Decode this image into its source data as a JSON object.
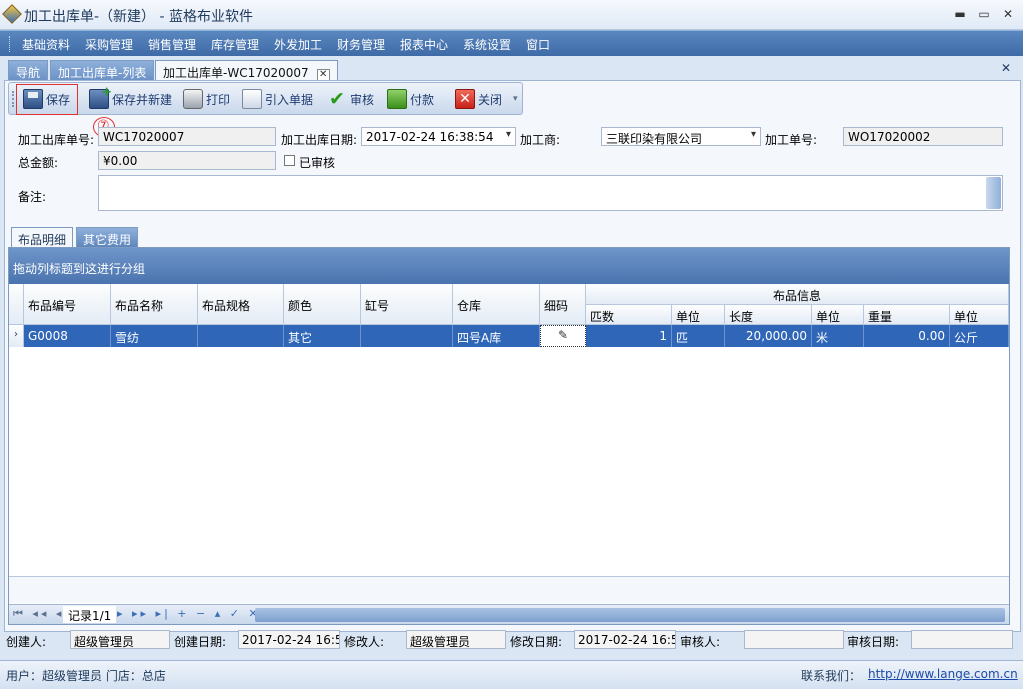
{
  "window": {
    "title": "加工出库单-（新建） - 蓝格布业软件",
    "minimize": "▬",
    "maximize": "▭",
    "close": "✕"
  },
  "menu": [
    "基础资料",
    "采购管理",
    "销售管理",
    "库存管理",
    "外发加工",
    "财务管理",
    "报表中心",
    "系统设置",
    "窗口"
  ],
  "doc_tabs": [
    {
      "label": "导航"
    },
    {
      "label": "加工出库单-列表"
    },
    {
      "label": "加工出库单-WC17020007",
      "close": "✕"
    }
  ],
  "close_all": "✕",
  "toolbar": {
    "save": "保存",
    "save_new": "保存并新建",
    "print": "打印",
    "import": "引入单据",
    "audit": "审核",
    "pay": "付款",
    "close": "关闭",
    "close_icon": "✕",
    "audit_icon": "✔",
    "dropdown": "▾"
  },
  "annotation": "⑦",
  "form": {
    "order_no_label": "加工出库单号:",
    "order_no": "WC17020007",
    "date_label": "加工出库日期:",
    "date": "2017-02-24 16:38:54",
    "processor_label": "加工商:",
    "processor": "三联印染有限公司",
    "process_no_label": "加工单号:",
    "process_no": "WO17020002",
    "total_label": "总金额:",
    "total": "¥0.00",
    "audited_label": "已审核",
    "remarks_label": "备注:"
  },
  "grid_tabs": [
    "布品明细",
    "其它费用"
  ],
  "grid": {
    "group_hint": "拖动列标题到这进行分组",
    "group_header": "布品信息",
    "columns": [
      "布品编号",
      "布品名称",
      "布品规格",
      "颜色",
      "缸号",
      "仓库",
      "细码"
    ],
    "sub_columns": [
      "匹数",
      "单位",
      "长度",
      "单位",
      "重量",
      "单位"
    ],
    "rows": [
      {
        "indicator": "›",
        "code": "G0008",
        "name": "雪纺",
        "spec": "",
        "color": "其它",
        "vat": "",
        "warehouse": "四号A库",
        "detail_icon": "✎",
        "pieces": "1",
        "unit1": "匹",
        "length": "20,000.00",
        "unit2": "米",
        "weight": "0.00",
        "unit3": "公斤"
      }
    ],
    "nav_first": "⏮ ◂◂ ◂",
    "record": "记录1/1",
    "nav_rest": "▸ ▸▸ ▸| + − ▴ ✓ ✕"
  },
  "audit_info": {
    "creator_label": "创建人:",
    "creator": "超级管理员",
    "create_date_label": "创建日期:",
    "create_date": "2017-02-24 16:5",
    "modifier_label": "修改人:",
    "modifier": "超级管理员",
    "modify_date_label": "修改日期:",
    "modify_date": "2017-02-24 16:5",
    "auditor_label": "审核人:",
    "auditor": "",
    "audit_date_label": "审核日期:",
    "audit_date": ""
  },
  "statusbar": {
    "user_store": "用户：超级管理员 门店：总店",
    "contact_label": "联系我们：",
    "contact_url": "http://www.lange.com.cn"
  }
}
